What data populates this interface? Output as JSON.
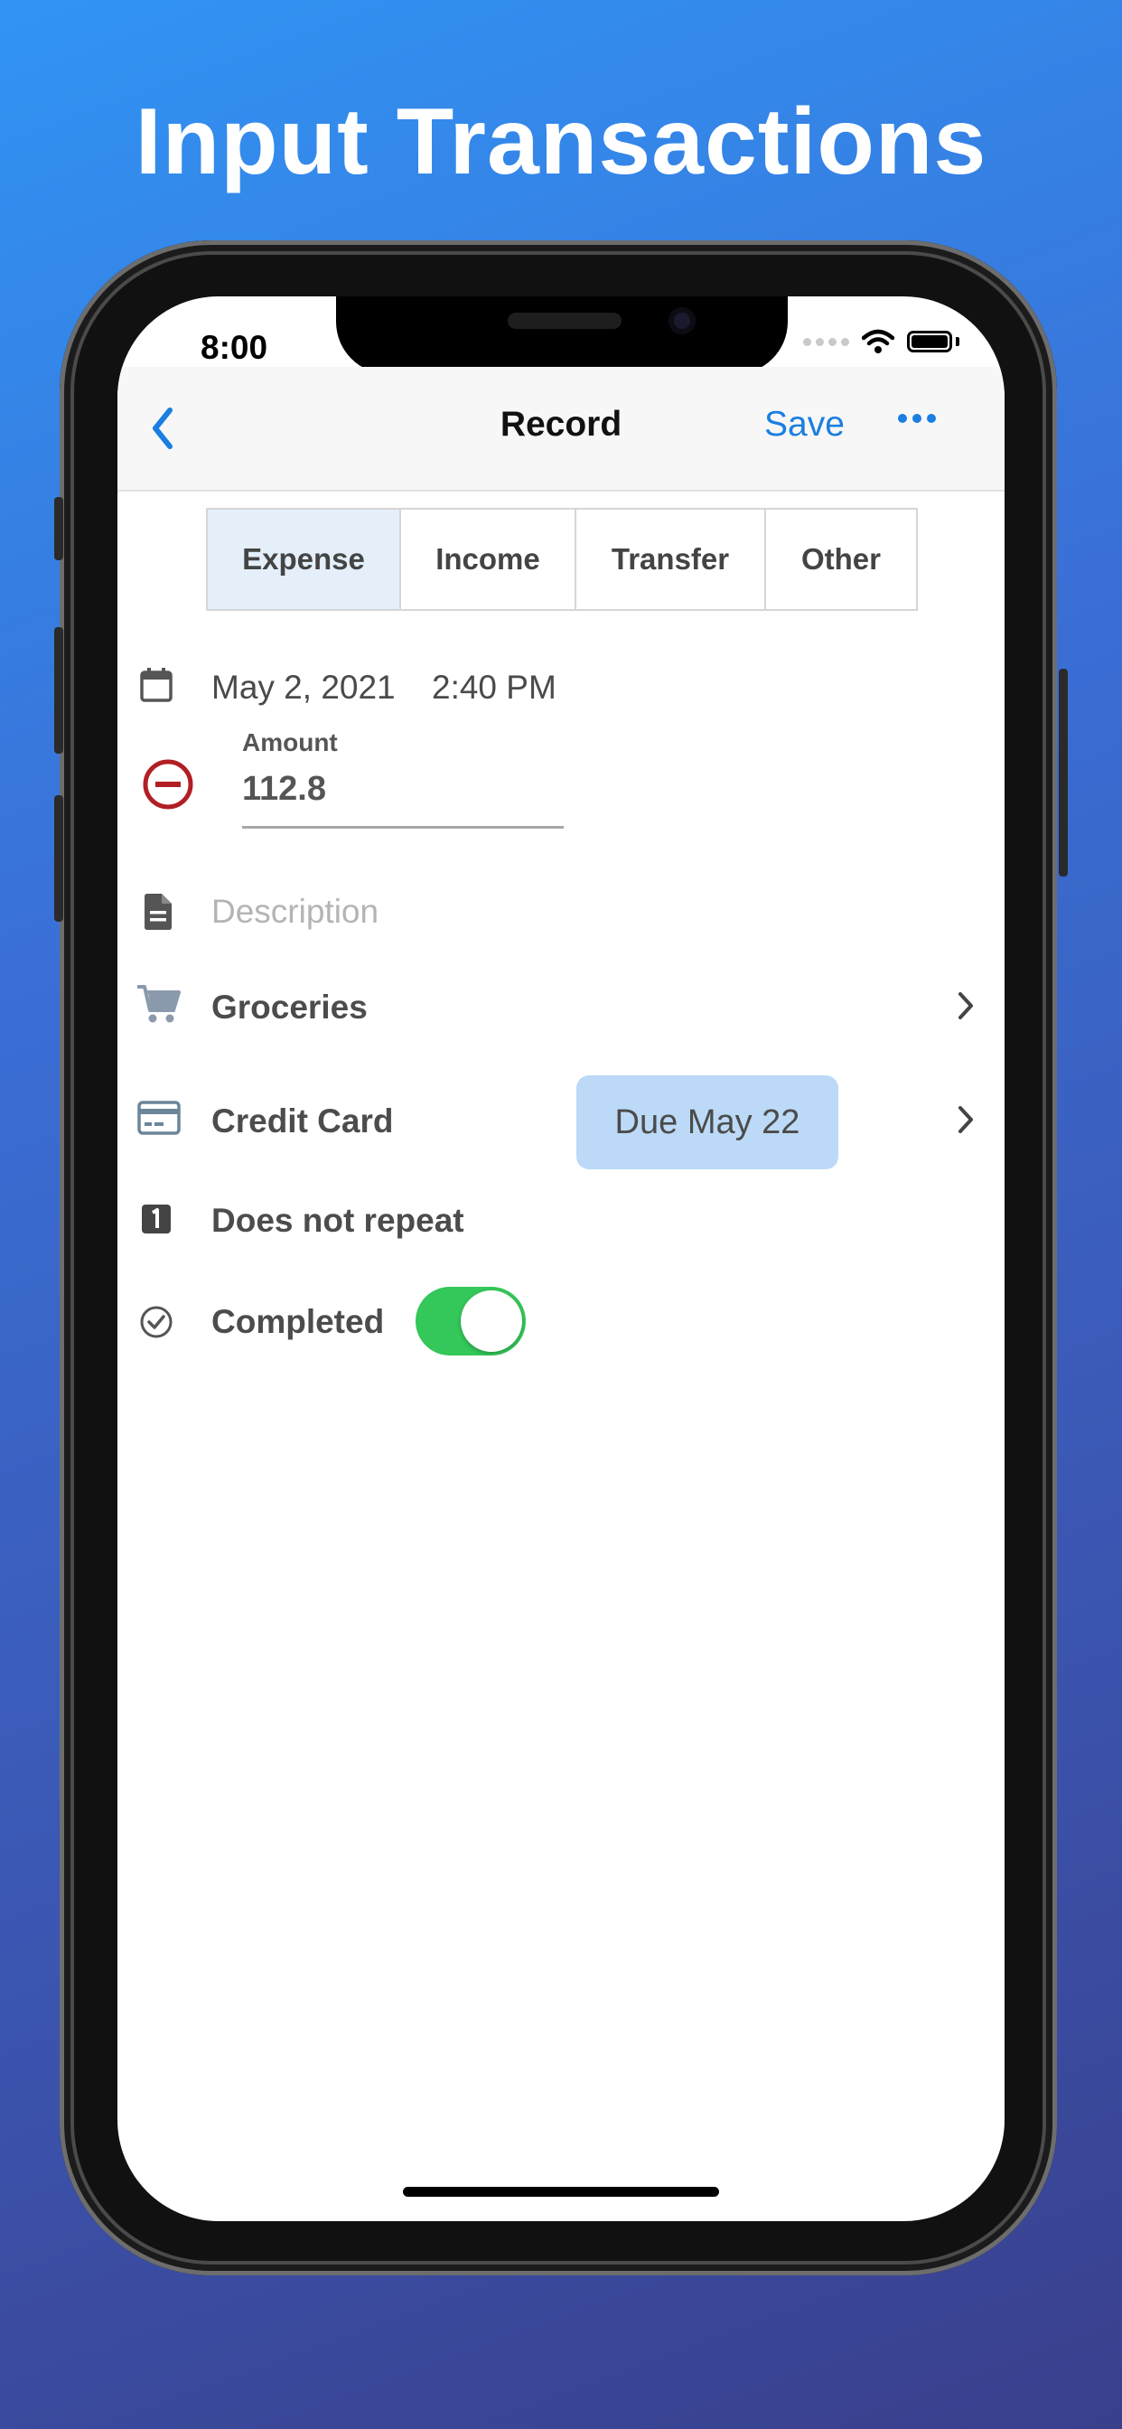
{
  "promo": {
    "headline": "Input Transactions"
  },
  "status_bar": {
    "time": "8:00"
  },
  "navbar": {
    "title": "Record",
    "save_label": "Save"
  },
  "segments": [
    {
      "label": "Expense",
      "selected": true
    },
    {
      "label": "Income",
      "selected": false
    },
    {
      "label": "Transfer",
      "selected": false
    },
    {
      "label": "Other",
      "selected": false
    }
  ],
  "form": {
    "date": "May 2, 2021",
    "time": "2:40 PM",
    "amount_label": "Amount",
    "amount_value": "112.8",
    "description_placeholder": "Description",
    "category": "Groceries",
    "account": "Credit Card",
    "due_badge": "Due May 22",
    "repeat": "Does not repeat",
    "completed_label": "Completed",
    "completed_on": true
  },
  "colors": {
    "accent": "#1a7fe0",
    "toggle_on": "#34c759",
    "minus_icon": "#b11f24",
    "selected_segment": "#e4effa",
    "due_badge": "#bcdaf7"
  },
  "icons": [
    "back-chevron-icon",
    "more-icon",
    "calendar-icon",
    "minus-circle-icon",
    "document-icon",
    "cart-icon",
    "credit-card-icon",
    "repeat-one-icon",
    "check-circle-icon",
    "chevron-right-icon"
  ]
}
